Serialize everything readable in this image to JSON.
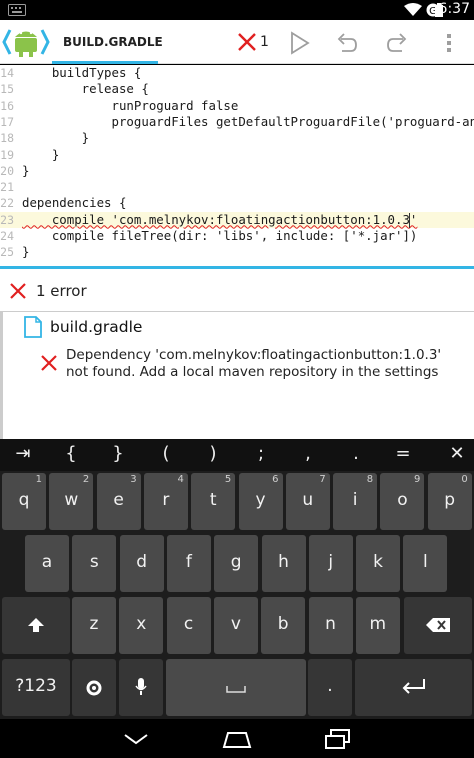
{
  "status_bar": {
    "time": "6:37"
  },
  "action_bar": {
    "file_tab": "BUILD.GRADLE",
    "error_count": "1",
    "icons": [
      "app-logo-icon",
      "error-x-icon",
      "run-icon",
      "undo-icon",
      "redo-icon",
      "overflow-menu-icon"
    ]
  },
  "editor": {
    "lines": [
      {
        "num": "14",
        "code": "    buildTypes {"
      },
      {
        "num": "15",
        "code": "        release {"
      },
      {
        "num": "16",
        "code": "            runProguard false"
      },
      {
        "num": "17",
        "code": "            proguardFiles getDefaultProguardFile('proguard-and"
      },
      {
        "num": "18",
        "code": "        }"
      },
      {
        "num": "19",
        "code": "    }"
      },
      {
        "num": "20",
        "code": "}"
      },
      {
        "num": "21",
        "code": ""
      },
      {
        "num": "22",
        "code": "dependencies {"
      },
      {
        "num": "23",
        "code": "    compile 'com.melnykov:floatingactionbutton:1.0.3'"
      },
      {
        "num": "24",
        "code": "    compile fileTree(dir: 'libs', include: ['*.jar'])"
      },
      {
        "num": "25",
        "code": "}"
      }
    ]
  },
  "errors_panel": {
    "summary": "1 error",
    "file": "build.gradle",
    "message": "Dependency 'com.melnykov:floatingactionbutton:1.0.3' not found. Add a local maven repository in the settings"
  },
  "keyboard": {
    "symbols": [
      "⇥",
      "{",
      "}",
      "(",
      ")",
      ";",
      ",",
      ".",
      "=",
      "✕"
    ],
    "row1": [
      {
        "label": "q",
        "hint": "1"
      },
      {
        "label": "w",
        "hint": "2"
      },
      {
        "label": "e",
        "hint": "3"
      },
      {
        "label": "r",
        "hint": "4"
      },
      {
        "label": "t",
        "hint": "5"
      },
      {
        "label": "y",
        "hint": "6"
      },
      {
        "label": "u",
        "hint": "7"
      },
      {
        "label": "i",
        "hint": "8"
      },
      {
        "label": "o",
        "hint": "9"
      },
      {
        "label": "p",
        "hint": "0"
      }
    ],
    "row2": [
      "a",
      "s",
      "d",
      "f",
      "g",
      "h",
      "j",
      "k",
      "l"
    ],
    "row3": [
      "z",
      "x",
      "c",
      "v",
      "b",
      "n",
      "m"
    ],
    "mode_label": "?123",
    "period_label": "."
  },
  "colors": {
    "accent": "#33b5e5",
    "error": "#e02020",
    "keyboard_bg": "#1d1d1d",
    "key": "#4a4a4a"
  }
}
